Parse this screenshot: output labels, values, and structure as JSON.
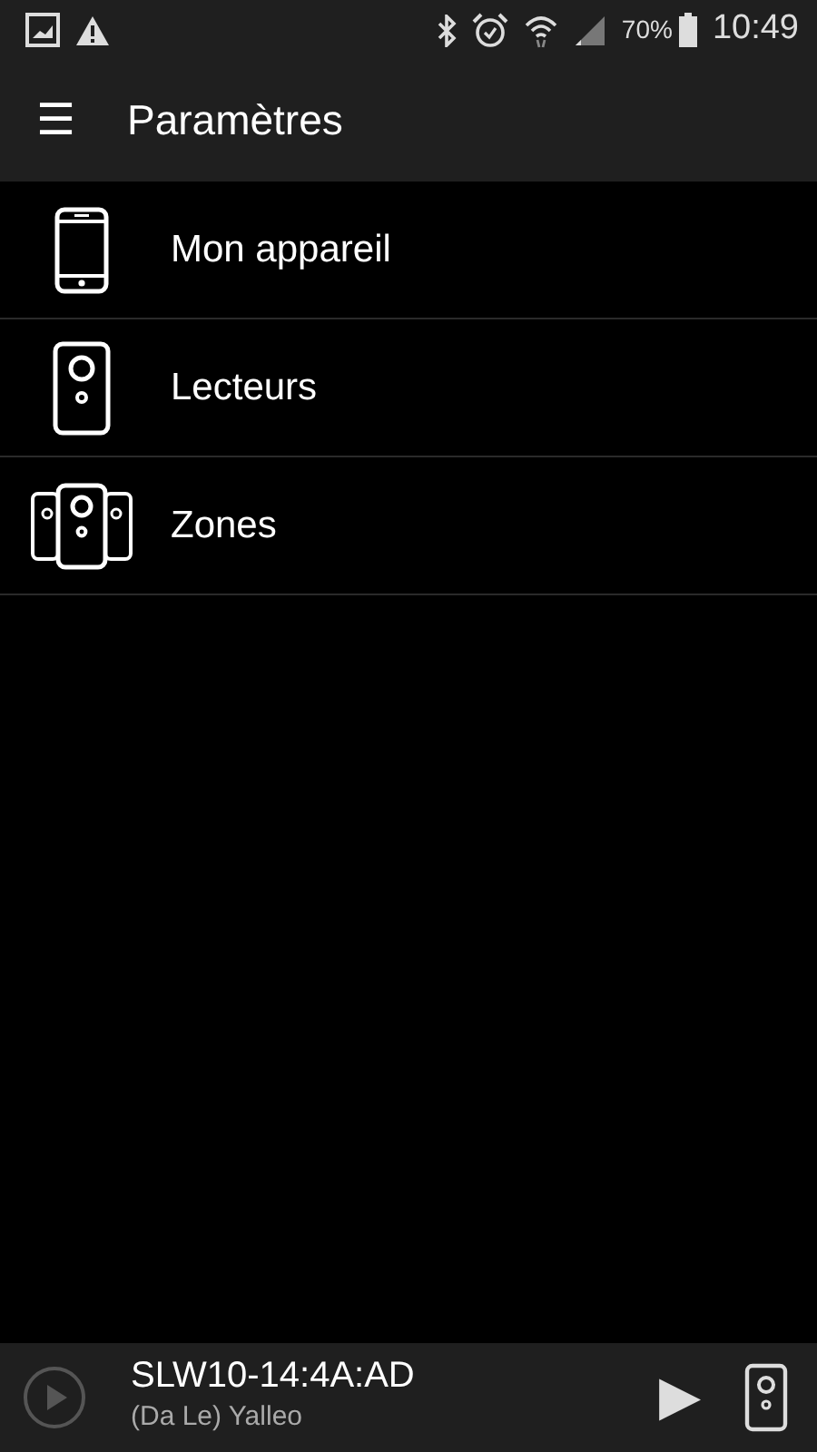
{
  "status_bar": {
    "battery": "70%",
    "time": "10:49"
  },
  "app_bar": {
    "menu_icon": "☰",
    "title": "Paramètres"
  },
  "items": [
    {
      "kind": "phone",
      "label": "Mon appareil"
    },
    {
      "kind": "speaker",
      "label": "Lecteurs"
    },
    {
      "kind": "zones",
      "label": "Zones"
    }
  ],
  "player": {
    "title": "SLW10-14:4A:AD",
    "subtitle": "(Da Le) Yalleo",
    "play": "▶"
  }
}
